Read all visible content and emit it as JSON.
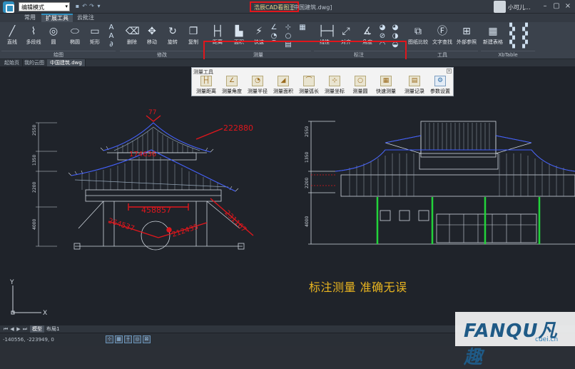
{
  "titlebar": {
    "mode_label": "编辑模式",
    "app_title": "浩辰CAD看图王",
    "file_title": "[中国建筑.dwg]",
    "user_name": "小可儿..."
  },
  "tabs": [
    "常用",
    "扩展工具",
    "云批注"
  ],
  "ribbon": {
    "draw": {
      "label": "绘图",
      "buttons": [
        "直线",
        "多段线",
        "圆",
        "椭圆",
        "矩形"
      ]
    },
    "modify": {
      "label": "修改",
      "buttons": [
        "删除",
        "移动",
        "旋转",
        "复制"
      ]
    },
    "measure": {
      "label": "测量",
      "buttons": [
        "距离",
        "面积",
        "快速"
      ]
    },
    "annotate": {
      "label": "标注",
      "buttons": [
        "线性",
        "对齐",
        "角度"
      ]
    },
    "tools": {
      "label": "工具",
      "buttons": [
        "图纸比较",
        "文字查找",
        "外部参照"
      ]
    },
    "xdtable": {
      "label": "XbTable",
      "buttons": [
        "新建表格"
      ]
    }
  },
  "doc_tabs": [
    "起始页",
    "我的云图",
    "中国建筑.dwg"
  ],
  "measure_panel": {
    "title": "测量工具",
    "buttons": [
      "测量距离",
      "测量角度",
      "测量半径",
      "测量面积",
      "测量弧长",
      "测量坐标",
      "测量圆",
      "快速测量",
      "测量记录",
      "参数设置"
    ]
  },
  "drawing": {
    "left_dims": [
      "2550",
      "1350",
      "2200",
      "4000"
    ],
    "right_dims": [
      "2550",
      "1350",
      "2200",
      "4000"
    ],
    "measure_values": [
      "77",
      "222880",
      "174636",
      "458857",
      "231167",
      "264537",
      "212435"
    ],
    "axis_y": "Y",
    "axis_x": "X"
  },
  "caption": "标注测量 准确无误",
  "layout_tabs": [
    "模型",
    "布局1"
  ],
  "status": {
    "coords": "-140556, -223949, 0"
  },
  "watermark": {
    "brand": "FANQU凡趣",
    "domain": "cuei.cn"
  },
  "colors": {
    "accent": "#2f8fbf",
    "highlight": "#e0161c",
    "dim_red": "#e0161c",
    "caption": "#e9b520",
    "column_green": "#22d33a"
  }
}
